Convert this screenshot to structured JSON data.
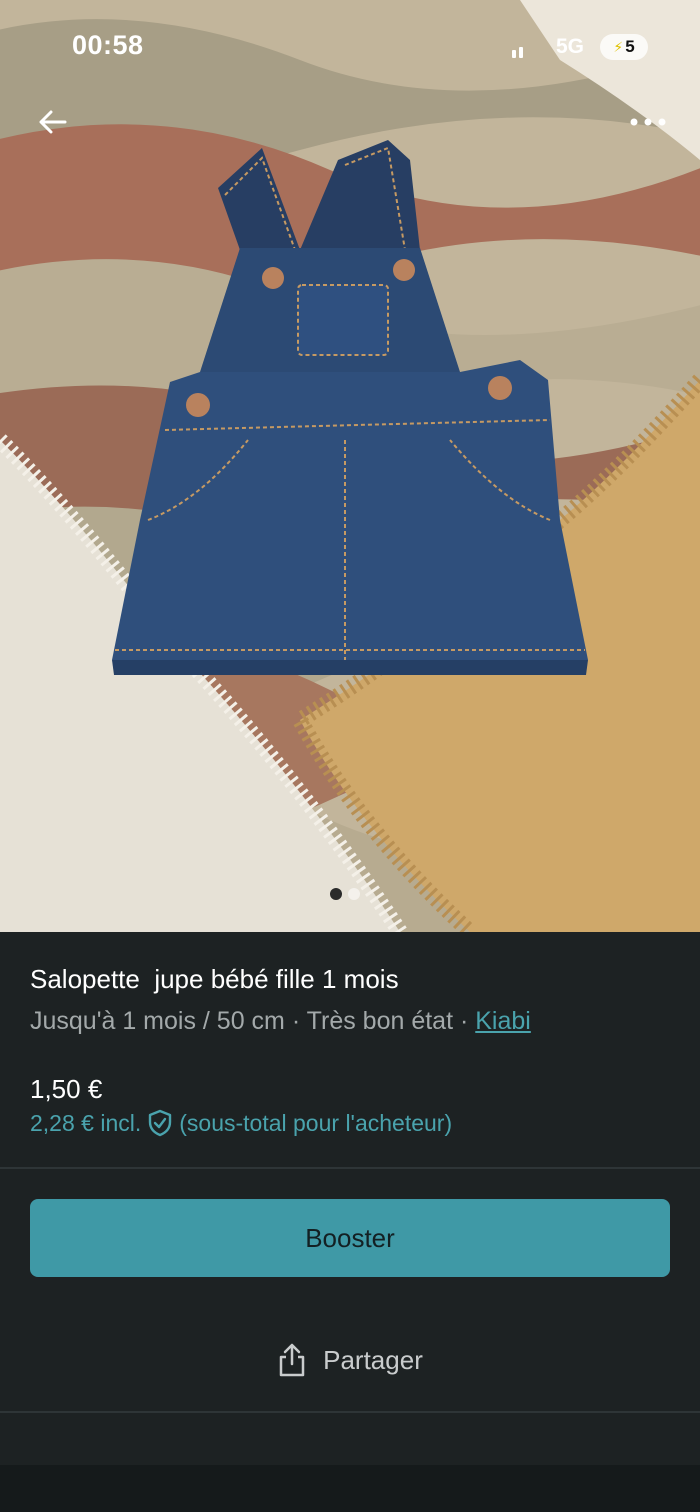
{
  "status_bar": {
    "time": "00:58",
    "network": "5G",
    "battery": "5"
  },
  "photo": {
    "pager": {
      "count": 2,
      "active_index": 0
    }
  },
  "product": {
    "title": "Salopette  jupe bébé fille 1 mois",
    "details": "Jusqu'à 1 mois / 50 cm · Très bon état · ",
    "brand": "Kiabi",
    "price": "1,50 €",
    "total_price": "2,28 € incl.",
    "total_note": "(sous-total pour l'acheteur)"
  },
  "actions": {
    "boost_label": "Booster",
    "share_label": "Partager"
  },
  "colors": {
    "accent": "#3f99a6",
    "link": "#4aa3ad",
    "background": "#1d2223"
  },
  "icons": [
    "back-arrow-icon",
    "more-dots-icon",
    "shield-check-icon",
    "share-icon",
    "signal-icon"
  ]
}
